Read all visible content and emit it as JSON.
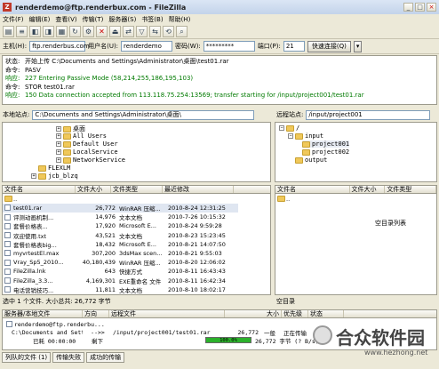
{
  "window": {
    "title": "renderdemo@ftp.renderbux.com - FileZilla"
  },
  "menu": [
    "文件(F)",
    "编辑(E)",
    "查看(V)",
    "传输(T)",
    "服务器(S)",
    "书签(B)",
    "帮助(H)"
  ],
  "quickconnect": {
    "host_label": "主机(H):",
    "host_value": "ftp.renderbus.com",
    "user_label": "用户名(U):",
    "user_value": "renderdemo",
    "pass_label": "密码(W):",
    "pass_value": "*********",
    "port_label": "端口(P):",
    "port_value": "21",
    "connect_label": "快速连接(Q)"
  },
  "log": [
    {
      "label": "状态:",
      "text": "开始上传 C:\\Documents and Settings\\Administrator\\桌面\\test01.rar",
      "type": "status"
    },
    {
      "label": "命令:",
      "text": "PASV",
      "type": "cmd"
    },
    {
      "label": "响应:",
      "text": "227 Entering Passive Mode (58,214,255,186,195,103)",
      "type": "resp"
    },
    {
      "label": "命令:",
      "text": "STOR test01.rar",
      "type": "cmd"
    },
    {
      "label": "响应:",
      "text": "150 Data connection accepted from 113.118.75.254:13569; transfer starting for /input/project001/test01.rar",
      "type": "resp"
    }
  ],
  "local": {
    "site_label": "本地站点:",
    "path": "C:\\Documents and Settings\\Administrator\\桌面\\",
    "tree": [
      "桌面",
      "All Users",
      "Default User",
      "LocalService",
      "NetworkService",
      "FLEXLM",
      "jcb_blzq"
    ],
    "headers": [
      "文件名",
      "文件大小",
      "文件类型",
      "最近修改"
    ],
    "files": [
      {
        "name": "..",
        "size": "",
        "type": "",
        "date": ""
      },
      {
        "name": "test01.rar",
        "size": "26,772",
        "type": "WinRAR 压缩...",
        "date": "2010-8-24 12:31:25"
      },
      {
        "name": "评测动画机制...",
        "size": "14,976",
        "type": "文本文档",
        "date": "2010-7-26 10:15:32"
      },
      {
        "name": "套餐价格表...",
        "size": "17,920",
        "type": "Microsoft E...",
        "date": "2010-8-24 9:59:28"
      },
      {
        "name": "欢迎使用.txt",
        "size": "43,521",
        "type": "文本文档",
        "date": "2010-8-23 15:23:45"
      },
      {
        "name": "套餐价格表big...",
        "size": "18,432",
        "type": "Microsoft E...",
        "date": "2010-8-21 14:07:50"
      },
      {
        "name": "myvrtestEl.max",
        "size": "307,200",
        "type": "3dsMax scen...",
        "date": "2010-8-21 9:55:03"
      },
      {
        "name": "Vray_Sp5_2010...",
        "size": "40,180,439",
        "type": "WinRAR 压缩...",
        "date": "2010-8-20 12:06:02"
      },
      {
        "name": "FileZilla.lnk",
        "size": "643",
        "type": "快捷方式",
        "date": "2010-8-11 16:43:43"
      },
      {
        "name": "FileZilla_3.3...",
        "size": "4,169,301",
        "type": "EXE重命名 文件",
        "date": "2010-8-11 16:42:34"
      },
      {
        "name": "电话营销技巧...",
        "size": "11,811",
        "type": "文本文档",
        "date": "2010-8-10 18:02:17"
      }
    ],
    "status": "选中 1 个文件. 大小总共: 26,772 字节"
  },
  "remote": {
    "site_label": "远程站点:",
    "path": "/input/project001",
    "tree": [
      "/",
      "input",
      "project001",
      "project002",
      "output"
    ],
    "headers": [
      "文件名",
      "文件大小",
      "文件类型"
    ],
    "files": [
      {
        "name": "..",
        "size": "",
        "type": ""
      }
    ],
    "empty_text": "空目录列表",
    "status": "空目录"
  },
  "queue": {
    "headers": [
      "服务器/本地文件",
      "方向",
      "远程文件",
      "大小",
      "优先级",
      "状态"
    ],
    "server": "renderdemo@ftp.renderbu...",
    "local_file": "C:\\Documents and Sett...",
    "direction": "-->>",
    "remote_file": "/input/project001/test01.rar",
    "size": "26,772",
    "priority": "一般",
    "state": "正在传输",
    "elapsed": "已耗 00:00:00",
    "remaining": "剩下",
    "progress_pct": 100,
    "progress_label": "100.0%",
    "transferred": "26,772 字节 (? B/s)",
    "tabs": [
      "列队的文件 (1)",
      "传输失败",
      "成功的传输"
    ]
  },
  "watermark": {
    "text": "合众软件园",
    "url": "www.hezhong.net"
  },
  "colors": {
    "accent": "#0a246a",
    "response": "#007a00",
    "progress": "#2bb12b"
  }
}
